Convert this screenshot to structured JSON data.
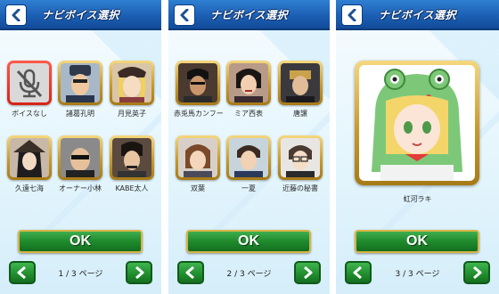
{
  "header": {
    "title": "ナビボイス選択"
  },
  "colors": {
    "header_blue": "#1c5fb4",
    "ok_green": "#1f8a2c",
    "gold_frame": "#c89a2e",
    "selected_red": "#d62318"
  },
  "screens": [
    {
      "characters": [
        {
          "name": "ボイスなし",
          "icon": "mic-off-icon"
        },
        {
          "name": "諸葛孔明"
        },
        {
          "name": "月見英子"
        },
        {
          "name": "久遠七海"
        },
        {
          "name": "オーナー小林"
        },
        {
          "name": "KABE太人"
        }
      ],
      "ok_label": "OK",
      "page_indicator": "1 / 3 ページ"
    },
    {
      "characters": [
        {
          "name": "赤兎馬カンフー"
        },
        {
          "name": "ミア西表"
        },
        {
          "name": "唐譲"
        },
        {
          "name": "双葉"
        },
        {
          "name": "一夏"
        },
        {
          "name": "近藤の秘書"
        }
      ],
      "ok_label": "OK",
      "page_indicator": "2 / 3 ページ"
    },
    {
      "characters": [
        {
          "name": "虹河ラキ"
        }
      ],
      "ok_label": "OK",
      "page_indicator": "3 / 3 ページ"
    }
  ]
}
